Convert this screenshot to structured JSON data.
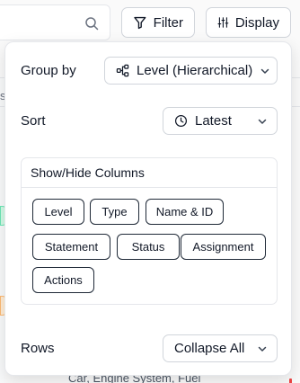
{
  "toolbar": {
    "filter_label": "Filter",
    "display_label": "Display"
  },
  "background": {
    "partial_header_letter": "s",
    "partial_row_text": "Car, Engine System, Fuel"
  },
  "display_panel": {
    "group_by": {
      "label": "Group by",
      "value": "Level (Hierarchical)"
    },
    "sort": {
      "label": "Sort",
      "value": "Latest"
    },
    "columns": {
      "title": "Show/Hide Columns",
      "items": [
        "Level",
        "Type",
        "Name & ID",
        "Statement",
        "Status",
        "Assignment",
        "Actions"
      ]
    },
    "rows": {
      "label": "Rows",
      "value": "Collapse All"
    }
  },
  "icons": {
    "search": "search-icon",
    "filter": "funnel-icon",
    "display": "sliders-icon",
    "group_by": "hierarchy-icon",
    "sort": "clock-icon",
    "dropdown": "chevron-down-icon"
  }
}
